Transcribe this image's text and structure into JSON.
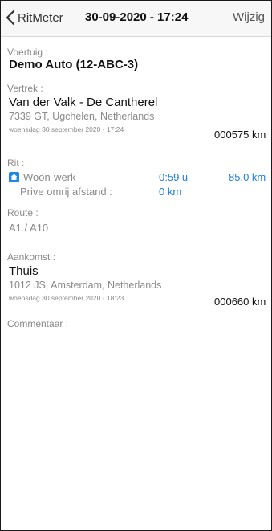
{
  "nav": {
    "back_label": "RitMeter",
    "title": "30-09-2020 - 17:24",
    "edit_label": "Wijzig"
  },
  "vehicle": {
    "label": "Voertuig :",
    "name": "Demo Auto (12-ABC-3)"
  },
  "departure": {
    "label": "Vertrek :",
    "place": "Van der Valk - De Cantherel",
    "address": "7339 GT, Ugchelen, Netherlands",
    "datetime": "woensdag 30 september 2020 - 17:24",
    "odometer": "000575 km"
  },
  "trip": {
    "label": "Rit :",
    "type": "Woon-werk",
    "duration": "0:59 u",
    "distance": "85.0 km",
    "private_label": "Prive omrij afstand :",
    "private_value": "0 km",
    "type_icon": "home-work-icon"
  },
  "route": {
    "label": "Route :",
    "value": "A1 / A10"
  },
  "arrival": {
    "label": "Aankomst :",
    "place": "Thuis",
    "address": "1012 JS, Amsterdam, Netherlands",
    "datetime": "woensdag 30 september 2020 - 18:23",
    "odometer": "000660 km"
  },
  "comment": {
    "label": "Commentaar :"
  },
  "colors": {
    "accent": "#1e7fd8",
    "label_gray": "#8a8a8a"
  }
}
